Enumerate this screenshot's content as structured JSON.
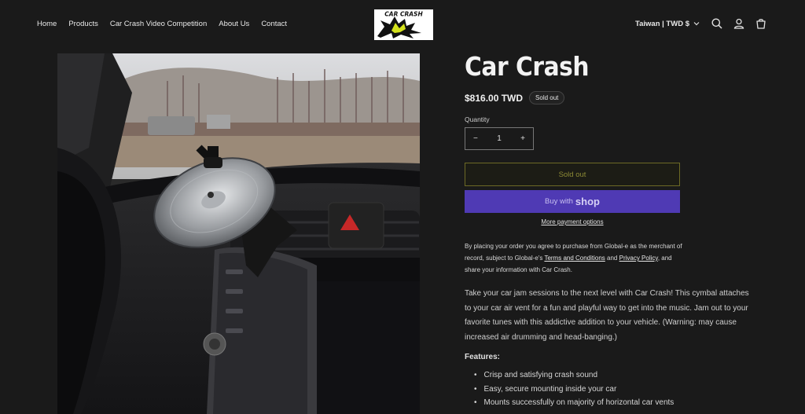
{
  "nav": {
    "items": [
      "Home",
      "Products",
      "Car Crash Video Competition",
      "About Us",
      "Contact"
    ]
  },
  "logo": {
    "text": "CAR CRASH"
  },
  "header": {
    "currency_label": "Taiwan | TWD $",
    "icons": [
      "chevron-down-icon",
      "search-icon",
      "account-icon",
      "cart-icon"
    ]
  },
  "product": {
    "title": "Car Crash",
    "price": "$816.00 TWD",
    "badge": "Sold out",
    "quantity_label": "Quantity",
    "quantity_value": "1",
    "minus": "−",
    "plus": "+",
    "sold_out_button": "Sold out",
    "buy_with": "Buy with",
    "shop": "shop",
    "more_payment": "More payment options",
    "legal": {
      "part1": "By placing your order you agree to purchase from Global-e as the merchant of record, subject to Global-e's ",
      "terms": "Terms and Conditions",
      "part2": " and ",
      "privacy": "Privacy Policy",
      "part3": ", and share your information with Car Crash."
    },
    "description": "Take your car jam sessions to the next level with Car Crash! This cymbal attaches to your car air vent for a fun and playful way to get into the music. Jam out to your favorite tunes with this addictive addition to your vehicle. (Warning: may cause increased air drumming and head-banging.)",
    "features_heading": "Features:",
    "features": [
      "Crisp and satisfying crash sound",
      "Easy, secure mounting inside your car",
      "Mounts successfully on majority of horizontal car vents"
    ]
  },
  "colors": {
    "background": "#1a1a1a",
    "shop_button": "#4f3ab4",
    "sold_out_border": "#6d6a25"
  }
}
